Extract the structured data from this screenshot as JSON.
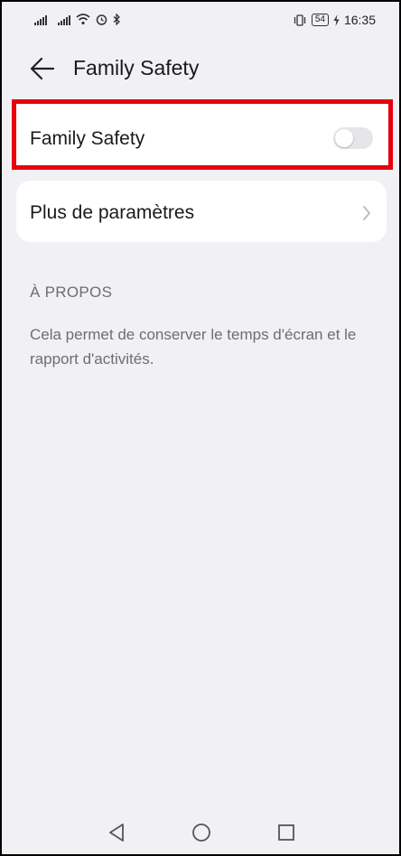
{
  "status_bar": {
    "time": "16:35",
    "battery_level": "54",
    "icons": [
      "signal-icon",
      "signal-icon",
      "wifi-icon",
      "alarm-icon",
      "bluetooth-icon",
      "vibrate-icon",
      "battery-icon",
      "charging-icon"
    ]
  },
  "header": {
    "title": "Family Safety",
    "back_icon": "back-arrow-icon"
  },
  "settings": {
    "family_safety_label": "Family Safety",
    "family_safety_enabled": false,
    "more_settings_label": "Plus de paramètres"
  },
  "about": {
    "section_title": "À PROPOS",
    "description": "Cela permet de conserver le temps d'écran et le rapport d'activités."
  },
  "nav_bar": {
    "icons": [
      "nav-back-icon",
      "nav-home-icon",
      "nav-recents-icon"
    ]
  },
  "colors": {
    "background": "#f1f0f5",
    "highlight_border": "#e8000c",
    "card": "#ffffff",
    "secondary_text": "#6d6d72"
  }
}
